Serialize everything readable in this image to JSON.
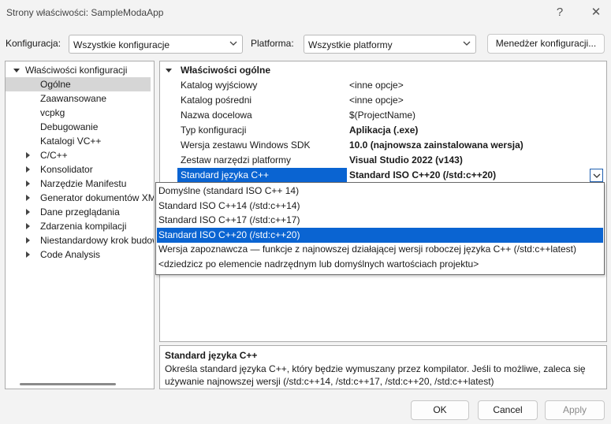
{
  "window": {
    "title": "Strony właściwości: SampleModaApp",
    "help_glyph": "?",
    "close_glyph": "✕"
  },
  "toolbar": {
    "config_label": "Konfiguracja:",
    "config_value": "Wszystkie konfiguracje",
    "platform_label": "Platforma:",
    "platform_value": "Wszystkie platformy",
    "manager_button": "Menedżer konfiguracji..."
  },
  "tree": {
    "root": "Właściwości konfiguracji",
    "items": [
      {
        "label": "Ogólne",
        "selected": true,
        "expander": false
      },
      {
        "label": "Zaawansowane",
        "selected": false,
        "expander": false
      },
      {
        "label": "vcpkg",
        "selected": false,
        "expander": false
      },
      {
        "label": "Debugowanie",
        "selected": false,
        "expander": false
      },
      {
        "label": "Katalogi VC++",
        "selected": false,
        "expander": false
      },
      {
        "label": "C/C++",
        "selected": false,
        "expander": true
      },
      {
        "label": "Konsolidator",
        "selected": false,
        "expander": true
      },
      {
        "label": "Narzędzie Manifestu",
        "selected": false,
        "expander": true
      },
      {
        "label": "Generator dokumentów XML",
        "selected": false,
        "expander": true
      },
      {
        "label": "Dane przeglądania",
        "selected": false,
        "expander": true
      },
      {
        "label": "Zdarzenia kompilacji",
        "selected": false,
        "expander": true
      },
      {
        "label": "Niestandardowy krok budowania",
        "selected": false,
        "expander": true
      },
      {
        "label": "Code Analysis",
        "selected": false,
        "expander": true
      }
    ]
  },
  "grid": {
    "section": "Właściwości ogólne",
    "rows": [
      {
        "name": "Katalog wyjściowy",
        "value": "<inne opcje>",
        "bold": false
      },
      {
        "name": "Katalog pośredni",
        "value": "<inne opcje>",
        "bold": false
      },
      {
        "name": "Nazwa docelowa",
        "value": "$(ProjectName)",
        "bold": false
      },
      {
        "name": "Typ konfiguracji",
        "value": "Aplikacja (.exe)",
        "bold": true
      },
      {
        "name": "Wersja zestawu Windows SDK",
        "value": "10.0 (najnowsza zainstalowana wersja)",
        "bold": true
      },
      {
        "name": "Zestaw narzędzi platformy",
        "value": "Visual Studio 2022 (v143)",
        "bold": true
      },
      {
        "name": "Standard języka C++",
        "value": "Standard ISO C++20 (/std:c++20)",
        "bold": true,
        "selected": true
      }
    ]
  },
  "dropdown": {
    "options": [
      {
        "label": "Domyślne (standard ISO C++ 14)",
        "highlighted": false
      },
      {
        "label": "Standard ISO C++14 (/std:c++14)",
        "highlighted": false
      },
      {
        "label": "Standard ISO C++17 (/std:c++17)",
        "highlighted": false
      },
      {
        "label": "Standard ISO C++20 (/std:c++20)",
        "highlighted": true
      },
      {
        "label": "Wersja zapoznawcza — funkcje z najnowszej działającej wersji roboczej języka C++ (/std:c++latest)",
        "highlighted": false
      },
      {
        "label": "<dziedzicz po elemencie nadrzędnym lub domyślnych wartościach projektu>",
        "highlighted": false
      }
    ]
  },
  "description": {
    "title": "Standard języka C++",
    "line1": "Określa standard języka C++, który będzie wymuszany przez kompilator. Jeśli to możliwe, zaleca się",
    "line2": "używanie najnowszej wersji (/std:c++14, /std:c++17, /std:c++20, /std:c++latest)"
  },
  "buttons": {
    "ok": "OK",
    "cancel": "Cancel",
    "apply": "Apply"
  },
  "colors": {
    "accent": "#0a64d2",
    "tree_selected": "#d6d6d6",
    "disabled_text": "#8a8a8a"
  }
}
